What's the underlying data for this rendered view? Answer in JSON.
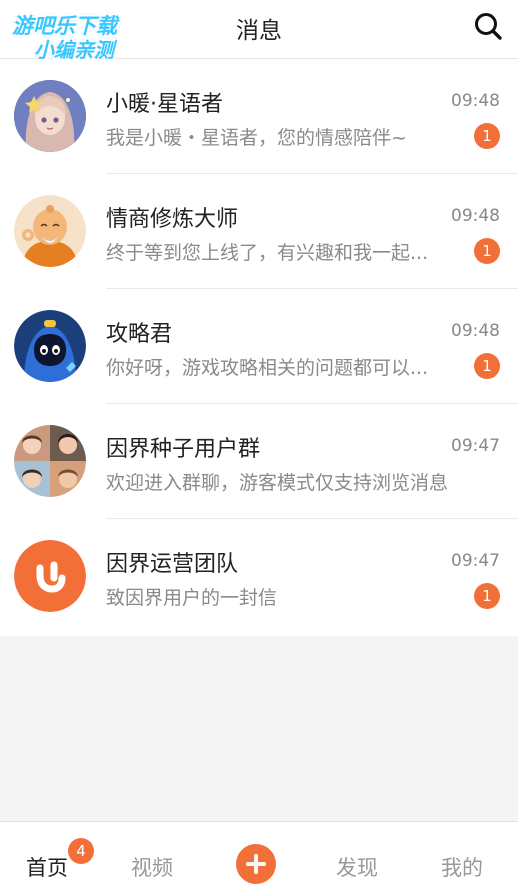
{
  "watermark": {
    "line1": "游吧乐下载",
    "line2": "小编亲测"
  },
  "header": {
    "title": "消息"
  },
  "icons": {
    "search": "search-icon",
    "plus": "plus-icon"
  },
  "colors": {
    "accent": "#f36f38",
    "watermark": "#38c8ff"
  },
  "conversations": [
    {
      "name": "小暖·星语者",
      "time": "09:48",
      "preview": "我是小暖・星语者，您的情感陪伴~",
      "badge": "1",
      "avatar": "anime-girl-avatar"
    },
    {
      "name": "情商修炼大师",
      "time": "09:48",
      "preview": "终于等到您上线了，有兴趣和我一起...",
      "badge": "1",
      "avatar": "monk-avatar"
    },
    {
      "name": "攻略君",
      "time": "09:48",
      "preview": "你好呀，游戏攻略相关的问题都可以...",
      "badge": "1",
      "avatar": "hooded-gamer-avatar"
    },
    {
      "name": "因界种子用户群",
      "time": "09:47",
      "preview": "欢迎进入群聊，游客模式仅支持浏览消息",
      "badge": "",
      "avatar": "group-avatar"
    },
    {
      "name": "因界运营团队",
      "time": "09:47",
      "preview": "致因界用户的一封信",
      "badge": "1",
      "avatar": "team-logo-avatar"
    }
  ],
  "nav": {
    "home": "首页",
    "home_badge": "4",
    "video": "视频",
    "discover": "发现",
    "me": "我的"
  }
}
